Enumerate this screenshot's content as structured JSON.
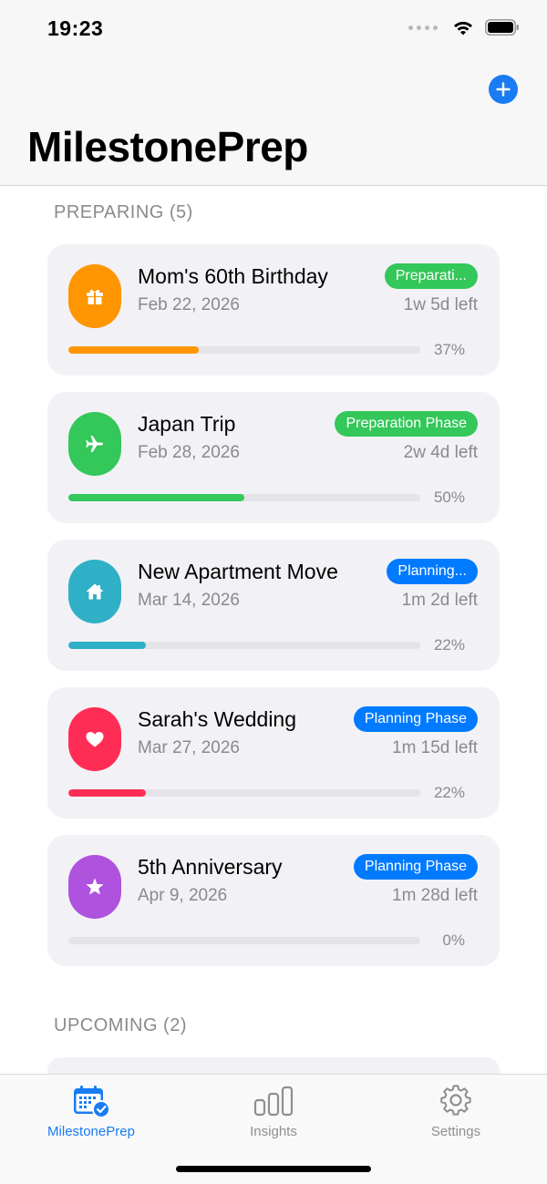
{
  "status_bar": {
    "time": "19:23"
  },
  "header": {
    "title": "MilestonePrep",
    "add_icon": "plus-icon"
  },
  "sections": [
    {
      "title": "PREPARING (5)"
    },
    {
      "title": "UPCOMING (2)"
    }
  ],
  "milestones": [
    {
      "title": "Mom's 60th Birthday",
      "date": "Feb 22, 2026",
      "badge": "Preparati...",
      "time_left": "1w 5d left",
      "progress_label": "37%",
      "progress": 0.37,
      "color": "#ff9500",
      "badge_color": "#34c759",
      "icon": "gift-icon"
    },
    {
      "title": "Japan Trip",
      "date": "Feb 28, 2026",
      "badge": "Preparation Phase",
      "time_left": "2w 4d left",
      "progress_label": "50%",
      "progress": 0.5,
      "color": "#34c759",
      "badge_color": "#34c759",
      "icon": "airplane-icon"
    },
    {
      "title": "New Apartment Move",
      "date": "Mar 14, 2026",
      "badge": "Planning...",
      "time_left": "1m 2d left",
      "progress_label": "22%",
      "progress": 0.22,
      "color": "#30b0c7",
      "badge_color": "#007aff",
      "icon": "house-icon"
    },
    {
      "title": "Sarah's Wedding",
      "date": "Mar 27, 2026",
      "badge": "Planning Phase",
      "time_left": "1m 15d left",
      "progress_label": "22%",
      "progress": 0.22,
      "color": "#ff2d55",
      "badge_color": "#007aff",
      "icon": "heart-icon"
    },
    {
      "title": "5th Anniversary",
      "date": "Apr 9, 2026",
      "badge": "Planning Phase",
      "time_left": "1m 28d left",
      "progress_label": "0%",
      "progress": 0.0,
      "color": "#af52de",
      "badge_color": "#007aff",
      "icon": "star-icon"
    }
  ],
  "tabs": [
    {
      "label": "MilestonePrep",
      "icon": "calendar-check-icon",
      "active": true
    },
    {
      "label": "Insights",
      "icon": "bar-chart-icon",
      "active": false
    },
    {
      "label": "Settings",
      "icon": "gear-icon",
      "active": false
    }
  ],
  "colors": {
    "accent": "#1a7cf2"
  }
}
